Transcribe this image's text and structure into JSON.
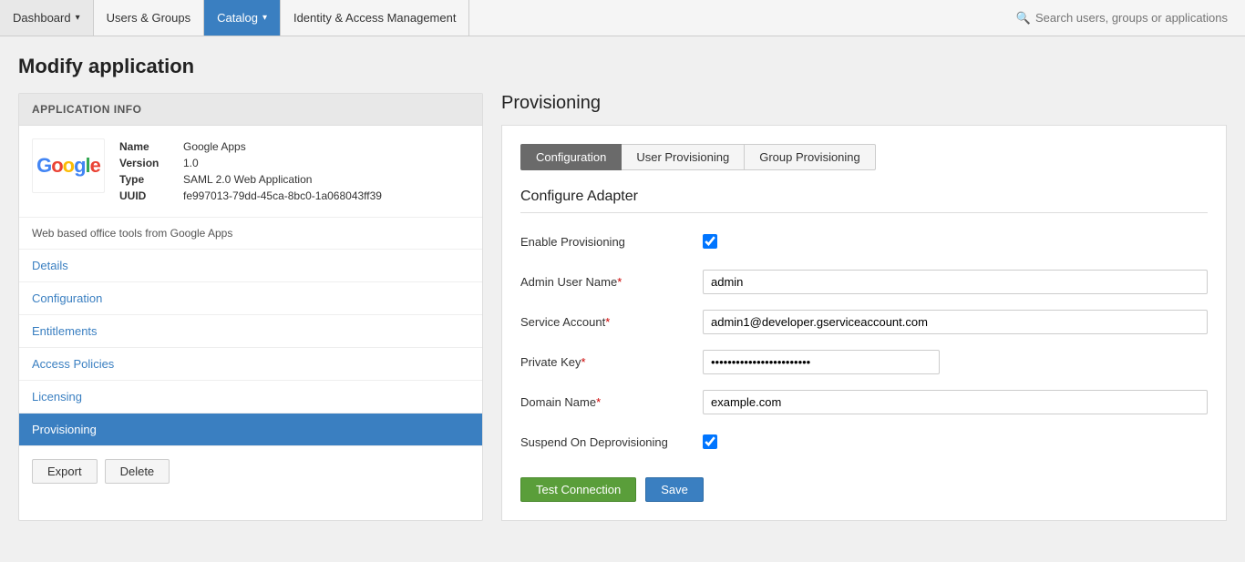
{
  "nav": {
    "items": [
      {
        "label": "Dashboard",
        "hasDropdown": true,
        "active": false
      },
      {
        "label": "Users & Groups",
        "hasDropdown": false,
        "active": false
      },
      {
        "label": "Catalog",
        "hasDropdown": true,
        "active": true
      },
      {
        "label": "Identity & Access Management",
        "hasDropdown": false,
        "active": false
      }
    ],
    "search_placeholder": "Search users, groups or applications"
  },
  "page": {
    "title": "Modify application"
  },
  "app_info": {
    "section_label": "APPLICATION INFO",
    "fields": {
      "name_label": "Name",
      "name_value": "Google Apps",
      "version_label": "Version",
      "version_value": "1.0",
      "type_label": "Type",
      "type_value": "SAML 2.0 Web Application",
      "uuid_label": "UUID",
      "uuid_value": "fe997013-79dd-45ca-8bc0-1a068043ff39"
    },
    "description": "Web based office tools from Google Apps"
  },
  "left_nav": [
    {
      "label": "Details",
      "active": false
    },
    {
      "label": "Configuration",
      "active": false
    },
    {
      "label": "Entitlements",
      "active": false
    },
    {
      "label": "Access Policies",
      "active": false
    },
    {
      "label": "Licensing",
      "active": false
    },
    {
      "label": "Provisioning",
      "active": true
    }
  ],
  "bottom_buttons": {
    "export_label": "Export",
    "delete_label": "Delete"
  },
  "right": {
    "section_title": "Provisioning",
    "tabs": [
      {
        "label": "Configuration",
        "active": true
      },
      {
        "label": "User Provisioning",
        "active": false
      },
      {
        "label": "Group Provisioning",
        "active": false
      }
    ],
    "configure_title": "Configure Adapter",
    "form": {
      "enable_provisioning_label": "Enable Provisioning",
      "admin_user_name_label": "Admin User Name",
      "admin_user_name_required": true,
      "admin_user_name_value": "admin",
      "service_account_label": "Service Account",
      "service_account_required": true,
      "service_account_value": "admin1@developer.gserviceaccount.com",
      "private_key_label": "Private Key",
      "private_key_required": true,
      "private_key_value": "••••••••••••••••••••••••",
      "domain_name_label": "Domain Name",
      "domain_name_required": true,
      "domain_name_value": "example.com",
      "suspend_label": "Suspend On Deprovisioning"
    },
    "buttons": {
      "test_label": "Test Connection",
      "save_label": "Save"
    }
  }
}
